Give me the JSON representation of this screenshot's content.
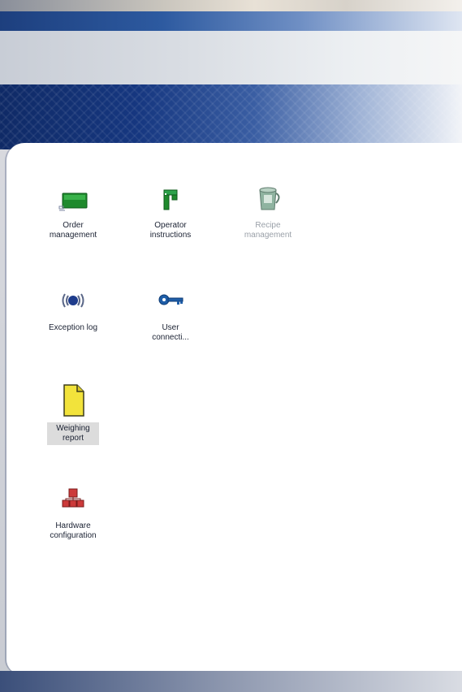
{
  "colors": {
    "banner_dark": "#163780",
    "title_bar": "#2d5aa0",
    "content_bg": "#ffffff",
    "disabled_text": "#9aa0a8"
  },
  "launcher": {
    "items": [
      {
        "label": "Order\nmanagement",
        "icon": "green-folder-icon",
        "enabled": true
      },
      {
        "label": "Operator\ninstructions",
        "icon": "green-pipe-icon",
        "enabled": true
      },
      {
        "label": "Recipe\nmanagement",
        "icon": "jug-icon",
        "enabled": false
      },
      {
        "label": "Exception log",
        "icon": "signal-icon",
        "enabled": true
      },
      {
        "label": "User\nconnecti...",
        "icon": "key-icon",
        "enabled": true
      },
      {
        "label": "Weighing\nreport",
        "icon": "document-icon",
        "enabled": true,
        "selected": true
      },
      {
        "label": "Hardware\nconfiguration",
        "icon": "hardware-blocks-icon",
        "enabled": true
      }
    ]
  }
}
